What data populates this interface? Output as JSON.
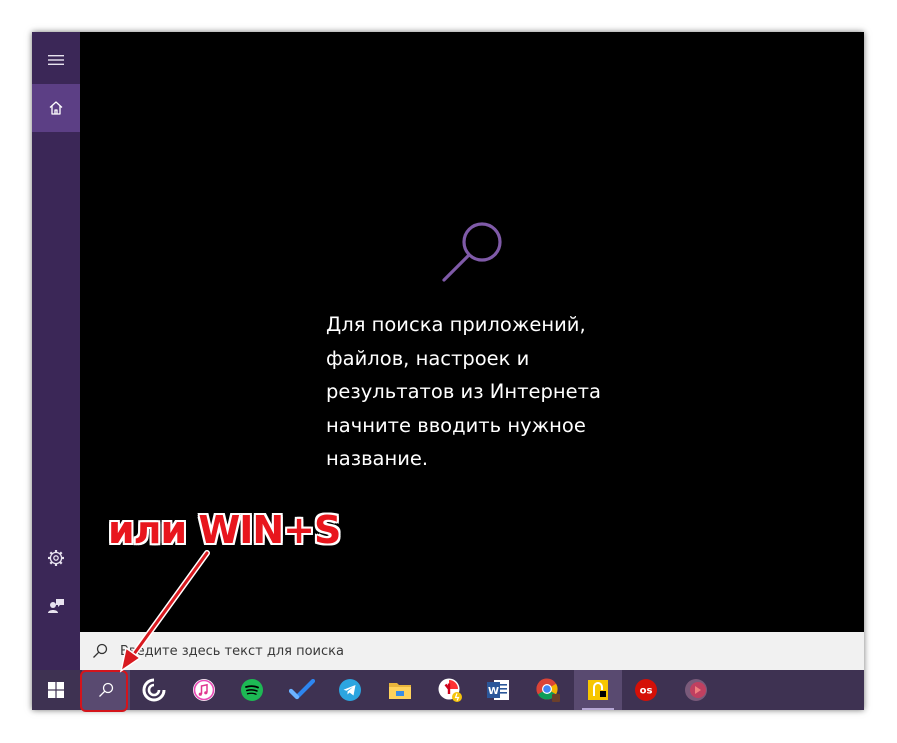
{
  "search_panel": {
    "hint_lines": [
      "Для поиска приложений,",
      "файлов, настроек и",
      "результатов из Интернета",
      "начните вводить нужное",
      "название."
    ]
  },
  "searchbar": {
    "placeholder": "Введите здесь текст для поиска"
  },
  "annotation": {
    "text": "или WIN+S"
  },
  "sidebar": {
    "items": [
      {
        "icon": "hamburger-menu-icon"
      },
      {
        "icon": "home-icon",
        "active": true
      },
      {
        "icon": "gear-icon"
      },
      {
        "icon": "user-feedback-icon"
      }
    ]
  },
  "taskbar": {
    "items": [
      {
        "icon": "windows-start-icon"
      },
      {
        "icon": "search-icon"
      },
      {
        "icon": "pocket-casts-icon"
      },
      {
        "icon": "itunes-icon"
      },
      {
        "icon": "spotify-icon"
      },
      {
        "icon": "todo-check-icon"
      },
      {
        "icon": "telegram-icon"
      },
      {
        "icon": "file-explorer-icon"
      },
      {
        "icon": "yandex-browser-icon"
      },
      {
        "icon": "word-icon"
      },
      {
        "icon": "chrome-icon"
      },
      {
        "icon": "notes-app-icon"
      },
      {
        "icon": "lastfm-icon"
      },
      {
        "icon": "media-player-icon"
      }
    ]
  },
  "colors": {
    "accent": "#7f5aa8",
    "sidebar": "#3b2757",
    "taskbar": "#3e3252",
    "annotation": "#e8161d"
  }
}
